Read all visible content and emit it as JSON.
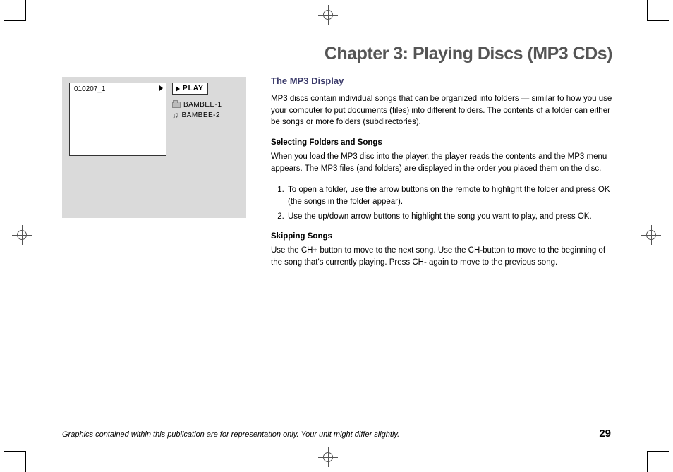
{
  "chapter_title": "Chapter 3: Playing Discs (MP3 CDs)",
  "figure": {
    "track_rows": [
      "010207_1",
      "",
      "",
      "",
      "",
      ""
    ],
    "play_label": "PLAY",
    "entries": [
      {
        "icon": "folder",
        "label": "BAMBEE-1"
      },
      {
        "icon": "note",
        "label": "BAMBEE-2"
      }
    ]
  },
  "section_heading": "The MP3 Display",
  "intro": "MP3 discs contain individual songs that can be organized into folders — similar to how you use your computer to put documents (files) into different folders. The contents of a folder can either be songs or more folders (subdirectories).",
  "sub1_heading": "Selecting Folders and Songs",
  "sub1_body": "When you load the MP3 disc into the player, the player reads the contents and the MP3 menu appears. The MP3 files (and folders) are displayed in the order you placed them on the disc.",
  "steps": [
    "To open a folder, use the arrow buttons on the remote to highlight the folder and press OK (the songs in the folder appear).",
    "Use the up/down arrow buttons to highlight the song you want to play, and press OK."
  ],
  "sub2_heading": "Skipping Songs",
  "sub2_body": "Use the CH+ button to move to the next song. Use the CH-button to move to the beginning of the song that's currently playing. Press CH- again to move to the previous song.",
  "footer_text": "Graphics contained within this publication are for representation only. Your unit might differ slightly.",
  "page_number": "29"
}
